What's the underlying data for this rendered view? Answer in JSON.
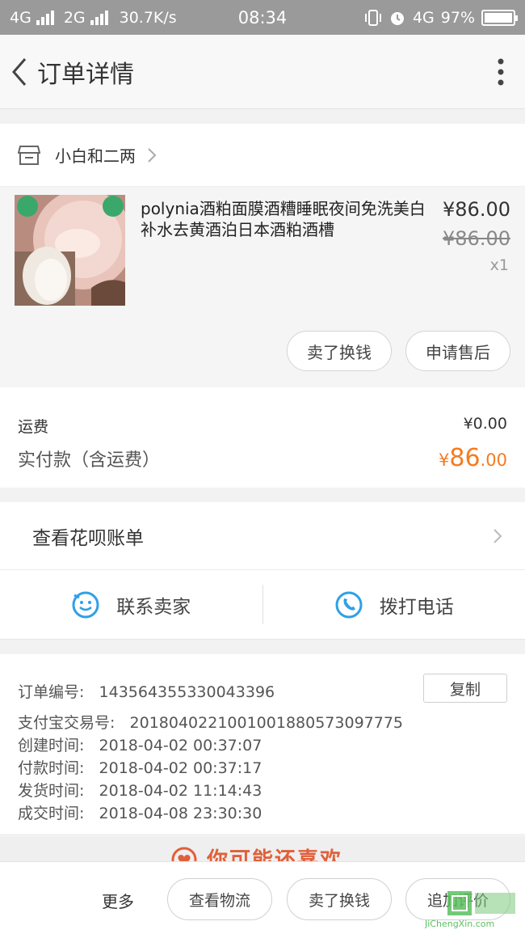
{
  "status_bar": {
    "net1": "4G",
    "net2": "2G",
    "speed": "30.7K/s",
    "time": "08:34",
    "net3": "4G",
    "battery": "97%"
  },
  "header": {
    "title": "订单详情"
  },
  "shop": {
    "name": "小白和二两"
  },
  "product": {
    "title": "polynia酒粕面膜酒糟睡眠夜间免洗美白补水去黄酒泊日本酒粕酒槽",
    "price": "¥86.00",
    "original_price": "¥86.00",
    "quantity": "x1",
    "actions": [
      "卖了换钱",
      "申请售后"
    ]
  },
  "fees": {
    "shipping_label": "运费",
    "shipping_value": "¥0.00",
    "paid_label": "实付款（含运费）",
    "paid_currency": "¥",
    "paid_int": "86",
    "paid_dec": ".00"
  },
  "huabei": {
    "label": "查看花呗账单"
  },
  "contact": {
    "seller": "联系卖家",
    "phone": "拨打电话"
  },
  "order_info": {
    "order_no_label": "订单编号:",
    "order_no": "143564355330043396",
    "copy_label": "复制",
    "alipay_label": "支付宝交易号:",
    "alipay_no": "2018040221001001880573097775",
    "created_label": "创建时间:",
    "created": "2018-04-02 00:37:07",
    "paid_label": "付款时间:",
    "paid": "2018-04-02 00:37:17",
    "shipped_label": "发货时间:",
    "shipped": "2018-04-02 11:14:43",
    "done_label": "成交时间:",
    "done": "2018-04-08 23:30:30"
  },
  "guess": {
    "text": "你可能还喜欢"
  },
  "bottom_bar": {
    "more": "更多",
    "logistics": "查看物流",
    "sell": "卖了换钱",
    "review": "追加评价"
  },
  "watermark": {
    "text": "JiChengXin.com"
  },
  "colors": {
    "accent": "#f57b1f",
    "icon_blue": "#2fa0e6",
    "status_bar": "#9a9a9a"
  }
}
